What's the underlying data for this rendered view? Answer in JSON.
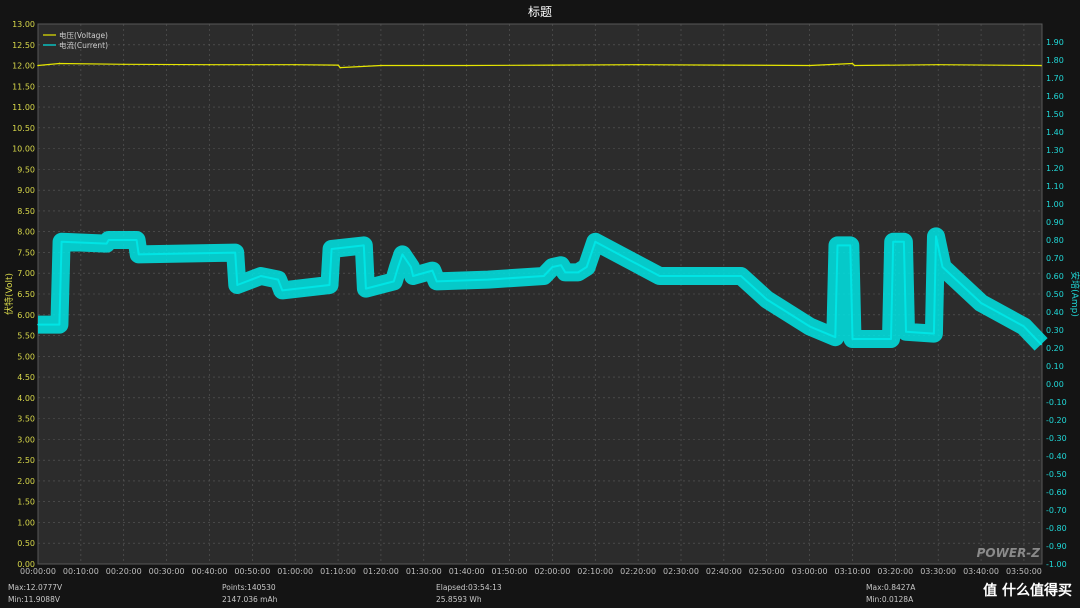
{
  "chart_data": {
    "type": "line",
    "title": "标题",
    "ylabel": "伏特(Volt)",
    "y2label": "安培(Amp)",
    "legend": {
      "position": "top-left",
      "entries": [
        "电压(Voltage)",
        "电流(Current)"
      ]
    },
    "grid": true,
    "ylim": [
      0.0,
      13.0
    ],
    "y2lim": [
      -1.0,
      2.0
    ],
    "xlim": [
      "00:00:00",
      "03:54:13"
    ],
    "x_ticks": [
      "00:00:00",
      "00:10:00",
      "00:20:00",
      "00:30:00",
      "00:40:00",
      "00:50:00",
      "01:00:00",
      "01:10:00",
      "01:20:00",
      "01:30:00",
      "01:40:00",
      "01:50:00",
      "02:00:00",
      "02:10:00",
      "02:20:00",
      "02:30:00",
      "02:40:00",
      "02:50:00",
      "03:00:00",
      "03:10:00",
      "03:20:00",
      "03:30:00",
      "03:40:00",
      "03:50:00"
    ],
    "y_ticks": [
      "0.00",
      "0.50",
      "1.00",
      "1.50",
      "2.00",
      "2.50",
      "3.00",
      "3.50",
      "4.00",
      "4.50",
      "5.00",
      "5.50",
      "6.00",
      "6.50",
      "7.00",
      "7.50",
      "8.00",
      "8.50",
      "9.00",
      "9.50",
      "10.00",
      "10.50",
      "11.00",
      "11.50",
      "12.00",
      "12.50",
      "13.00"
    ],
    "y2_ticks": [
      "-1.00",
      "-0.90",
      "-0.80",
      "-0.70",
      "-0.60",
      "-0.50",
      "-0.40",
      "-0.30",
      "-0.20",
      "-0.10",
      "0.00",
      "0.10",
      "0.20",
      "0.30",
      "0.40",
      "0.50",
      "0.60",
      "0.70",
      "0.80",
      "0.90",
      "1.00",
      "1.10",
      "1.20",
      "1.30",
      "1.40",
      "1.50",
      "1.60",
      "1.70",
      "1.80",
      "1.90"
    ],
    "series": [
      {
        "name": "电压(Voltage)",
        "axis": "left",
        "color": "#e6e600",
        "x": [
          "00:00:00",
          "00:05:00",
          "00:20:00",
          "00:40:00",
          "01:00:00",
          "01:10:00",
          "01:10:30",
          "01:20:00",
          "01:40:00",
          "02:00:00",
          "02:20:00",
          "02:40:00",
          "03:00:00",
          "03:10:00",
          "03:10:30",
          "03:30:00",
          "03:54:00"
        ],
        "values": [
          12.0,
          12.05,
          12.03,
          12.02,
          12.02,
          12.01,
          11.95,
          12.0,
          12.0,
          12.01,
          12.02,
          12.01,
          12.0,
          12.05,
          12.0,
          12.02,
          12.0
        ]
      },
      {
        "name": "电流(Current)",
        "axis": "right",
        "color": "#00e5e5",
        "x": [
          "00:00:00",
          "00:05:00",
          "00:05:30",
          "00:16:00",
          "00:16:30",
          "00:23:00",
          "00:23:30",
          "00:46:00",
          "00:46:30",
          "00:52:00",
          "00:56:00",
          "00:57:00",
          "01:08:00",
          "01:08:30",
          "01:16:00",
          "01:16:30",
          "01:23:00",
          "01:24:00",
          "01:25:00",
          "01:27:00",
          "01:27:30",
          "01:32:00",
          "01:33:00",
          "01:45:00",
          "01:58:00",
          "02:00:00",
          "02:02:00",
          "02:03:00",
          "02:06:00",
          "02:08:00",
          "02:10:00",
          "02:25:00",
          "02:41:00",
          "02:44:00",
          "02:50:00",
          "03:00:00",
          "03:06:00",
          "03:06:30",
          "03:09:30",
          "03:10:00",
          "03:19:00",
          "03:19:30",
          "03:22:00",
          "03:22:30",
          "03:29:00",
          "03:29:30",
          "03:31:00",
          "03:40:00",
          "03:50:00",
          "03:54:00"
        ],
        "values": [
          0.33,
          0.33,
          0.79,
          0.78,
          0.8,
          0.8,
          0.72,
          0.73,
          0.55,
          0.6,
          0.58,
          0.52,
          0.55,
          0.75,
          0.77,
          0.53,
          0.57,
          0.65,
          0.72,
          0.65,
          0.6,
          0.63,
          0.57,
          0.58,
          0.6,
          0.65,
          0.66,
          0.62,
          0.62,
          0.65,
          0.79,
          0.6,
          0.6,
          0.6,
          0.47,
          0.32,
          0.26,
          0.77,
          0.77,
          0.25,
          0.25,
          0.79,
          0.79,
          0.29,
          0.28,
          0.82,
          0.65,
          0.45,
          0.32,
          0.22
        ]
      }
    ]
  },
  "stats": {
    "max_v": "Max:12.0777V",
    "min_v": "Min:11.9088V",
    "points": "Points:140530",
    "mah": "2147.036 mAh",
    "elapsed": "Elapsed:03:54:13",
    "wh": "25.8593 Wh",
    "max_a": "Max:0.8427A",
    "min_a": "Min:0.0128A"
  },
  "watermark": "POWER-Z",
  "logo": "值 什么值得买"
}
